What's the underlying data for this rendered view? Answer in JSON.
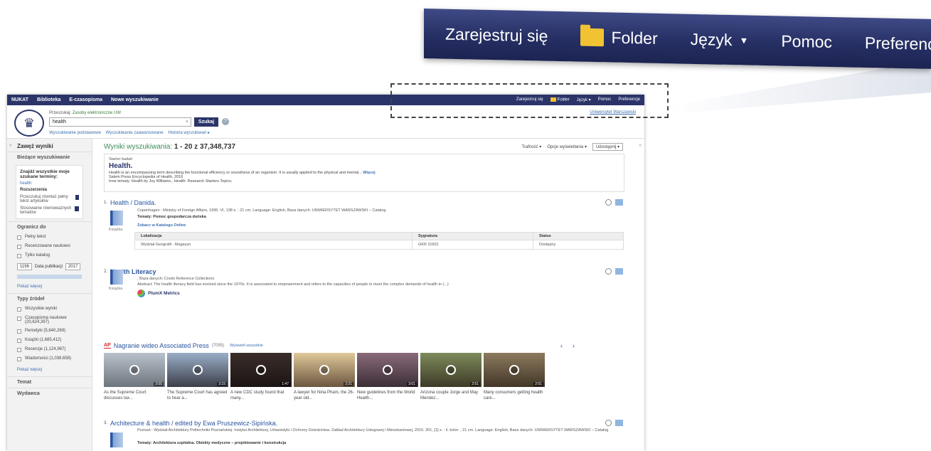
{
  "zoom_toolbar": {
    "register": "Zarejestruj się",
    "folder": "Folder",
    "language": "Język",
    "language_caret": "▼",
    "help": "Pomoc",
    "preferences": "Preferencje"
  },
  "topnav": {
    "items": [
      "NUKAT",
      "Biblioteka",
      "E-czasopisma",
      "Nowe wyszukiwanie"
    ],
    "right": {
      "register": "Zarejestruj się",
      "folder": "Folder",
      "language": "Język ▾",
      "help": "Pomoc",
      "preferences": "Preferencje"
    }
  },
  "header": {
    "search_for_label": "Przeszukaj:",
    "search_for_value": "Zasoby elektroniczne UW",
    "query": "health",
    "clear": "×",
    "search_button": "Szukaj",
    "help_icon": "?",
    "links": [
      "Wyszukiwanie podstawowe",
      "Wyszukiwanie zaawansowane",
      "Historia wyszukiwań ▸"
    ],
    "institution": "Uniwersytet Warszawski"
  },
  "left": {
    "refine": "Zawęż wyniki",
    "current": "Bieżące wyszukiwanie",
    "find_all": "Znajdź wszystkie moje szukane terminy:",
    "term": "health",
    "expansions": "Rozszerzenia",
    "exp1": "Przeszukuj również pełny tekst artykułów",
    "exp2": "Stosowanie równoważnych tematów",
    "limit": "Ogranicz do",
    "limits": [
      "Pełny tekst",
      "Recenzowane naukowo",
      "Tylko katalog"
    ],
    "date_from": "1196",
    "date_label": "Data publikacji",
    "date_to": "2017",
    "show_more": "Pokaż więcej",
    "source_types": "Typy źródeł",
    "sources": [
      "Wszystkie wyniki",
      "Czasopisma naukowe (20,624,397)",
      "Periodyki (5,640,269)",
      "Książki (1,685,412)",
      "Recenzje (1,124,967)",
      "Wiadomości (1,038,658)"
    ],
    "show_more2": "Pokaż więcej",
    "subject": "Temat",
    "publisher": "Wydawca"
  },
  "results": {
    "heading": "Wyniki wyszukiwania:",
    "range": "1 - 20 z 37,348,737",
    "relevance": "Trafność ▾",
    "display": "Opcje wyświetlania ▾",
    "share": "Udostępnij ▾",
    "starter": {
      "label": "Starter badań",
      "title": "Health.",
      "text": "Health is an encompassing term describing the functional efficiency or soundness of an organism. It is usually applied to the physical and mental...",
      "more": "Więcej",
      "source": "Salem Press Encyclopedia of Health, 2016",
      "other": "Inne tematy: Health by Joy Williams., Health: Research Starters Topics."
    },
    "rec1": {
      "num": "1.",
      "title": "Health / Danida.",
      "meta": "Copenhagen : Ministry of Foreign Affairs, 1995. VI, 138 s. ; 21 cm. Language: English, Baza danych: UNIWERSYTET WARSZAWSKI – Catalog",
      "subjects": "Tematy: Pomoc gospodarcza duńska",
      "format": "Książka",
      "catalog_link": "Zobacz w Katalogu Online",
      "cols": [
        "Lokalizacja",
        "Sygnatura",
        "Status"
      ],
      "row": [
        "Wydział Geografii - Magazyn",
        "GKR 31831",
        "Dostępny"
      ]
    },
    "rec2": {
      "num": "2.",
      "title": "Health Literacy",
      "meta": ", Baza danych: Credo Reference Collections",
      "abstract": "Abstract: The health literacy field has evolved since the 1970s. It is associated to empowerment and refers to the capacities of people to meet the complex demands of health in (...)",
      "format": "Książka",
      "plumx": "PlumX Metrics"
    },
    "ap": {
      "logo": "AP",
      "title": "Nagranie wideo Associated Press",
      "count": "(7095)",
      "all": "Wyświetl wszystkie",
      "prev": "‹",
      "next": "›",
      "videos": [
        {
          "dur": "3:05",
          "cap": "As the Supreme Court discusses tax..."
        },
        {
          "dur": "3:15",
          "cap": "The Supreme Court has agreed to hear a..."
        },
        {
          "dur": "1:47",
          "cap": "A new CDC study found that many..."
        },
        {
          "dur": "2:21",
          "cap": "A lawyer for Nina Pham, the 26-year old..."
        },
        {
          "dur": "3:01",
          "cap": "New guidelines from the World Health..."
        },
        {
          "dur": "2:51",
          "cap": "Arizona couple Jorge and May Mendez..."
        },
        {
          "dur": "2:01",
          "cap": "Many consumers getting health care..."
        }
      ]
    },
    "rec3": {
      "num": "3.",
      "title": "Architecture & health / edited by Ewa Pruszewicz-Sipińska.",
      "meta": "Poznań : Wydział Architektury Politechniki Poznańskiej. Instytut Architektury, Urbanistyki i Ochrony Dziedzictwa. Zakład Architektury Usługowej i Mieszkaniowej, 2015. 301, [1] s. : il. kolor. ; 21 cm. Language: English, Baza danych: UNIWERSYTET WARSZAWSKI – Catalog",
      "subjects": "Tematy: Architektura szpitalna. Obiekty medyczne – projektowanie i konstrukcja"
    }
  },
  "colors": {
    "nav": "#2a3468",
    "link": "#2a56a0",
    "accent_green": "#3c8a5a",
    "folder": "#f1c232"
  }
}
